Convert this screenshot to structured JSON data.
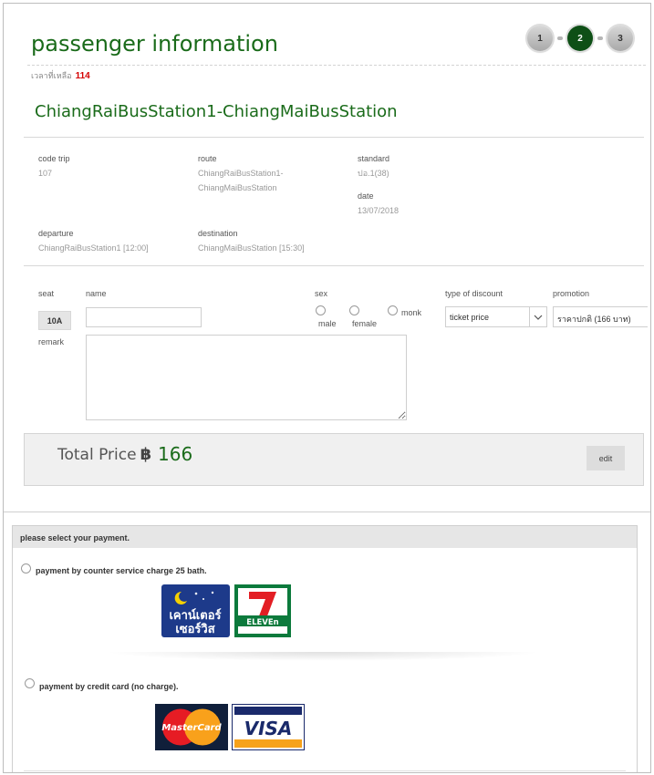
{
  "page": {
    "title": "passenger information"
  },
  "steps": [
    {
      "label": "1",
      "active": false
    },
    {
      "label": "2",
      "active": true
    },
    {
      "label": "3",
      "active": false
    }
  ],
  "timer": {
    "label": "เวลาที่เหลือ",
    "value": "114"
  },
  "route_title": "ChiangRaiBusStation1-ChiangMaiBusStation",
  "trip": {
    "code_label": "code trip",
    "code_value": "107",
    "route_label": "route",
    "route_line1": "ChiangRaiBusStation1-",
    "route_line2": "ChiangMaiBusStation",
    "standard_label": "standard",
    "standard_value": "ปอ.1(38)",
    "date_label": "date",
    "date_value": "13/07/2018",
    "departure_label": "departure",
    "departure_value": "ChiangRaiBusStation1 [12:00]",
    "destination_label": "destination",
    "destination_value": "ChiangMaiBusStation [15:30]"
  },
  "passenger": {
    "seat_label": "seat",
    "seat_value": "10A",
    "name_label": "name",
    "name_value": "",
    "sex_label": "sex",
    "sex_options": [
      "male",
      "female",
      "monk"
    ],
    "discount_label": "type of discount",
    "discount_value": "ticket price",
    "promotion_label": "promotion",
    "promotion_value": "ราคาปกติ (166 บาท)",
    "remark_label": "remark"
  },
  "total": {
    "label": "Total Price",
    "currency": "฿",
    "value": "166",
    "edit_label": "edit"
  },
  "payment": {
    "header": "please select your payment.",
    "counter_label": "payment by counter service charge 25 bath.",
    "counter_logo_line1": "เคาน์เตอร์",
    "counter_logo_line2": "เซอร์วิส",
    "seven_logo_text": "ELEVEn",
    "credit_label": "payment by credit card (no charge).",
    "mastercard_text": "MasterCard",
    "visa_text": "VISA"
  },
  "colors": {
    "brand_green": "#1a6b1a",
    "step_active": "#0e4f16",
    "timer_red": "#d40000"
  }
}
